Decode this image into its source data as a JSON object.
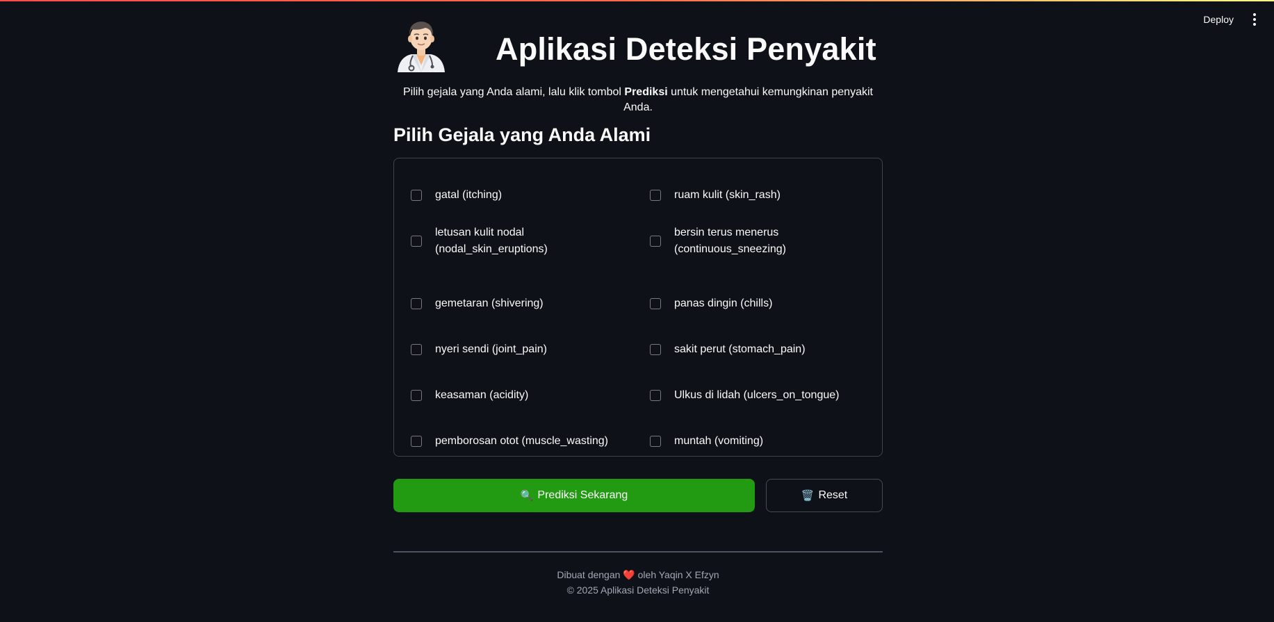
{
  "toolbar": {
    "deploy_label": "Deploy",
    "menu_icon": "kebab-menu-icon"
  },
  "header": {
    "avatar_icon": "doctor-avatar-icon",
    "title": "Aplikasi Deteksi Penyakit"
  },
  "intro": {
    "before": "Pilih gejala yang Anda alami, lalu klik tombol ",
    "bold": "Prediksi",
    "after": " untuk mengetahui kemungkinan penyakit Anda."
  },
  "section_title": "Pilih Gejala yang Anda Alami",
  "symptoms": [
    {
      "label": "gatal (itching)",
      "checked": false
    },
    {
      "label": "ruam kulit (skin_rash)",
      "checked": false
    },
    {
      "label": "letusan kulit nodal (nodal_skin_eruptions)",
      "checked": false
    },
    {
      "label": "bersin terus menerus (continuous_sneezing)",
      "checked": false
    },
    {
      "label": "gemetaran (shivering)",
      "checked": false
    },
    {
      "label": "panas dingin (chills)",
      "checked": false
    },
    {
      "label": "nyeri sendi (joint_pain)",
      "checked": false
    },
    {
      "label": "sakit perut (stomach_pain)",
      "checked": false
    },
    {
      "label": "keasaman (acidity)",
      "checked": false
    },
    {
      "label": "Ulkus di lidah (ulcers_on_tongue)",
      "checked": false
    },
    {
      "label": "pemborosan otot (muscle_wasting)",
      "checked": false
    },
    {
      "label": "muntah (vomiting)",
      "checked": false
    }
  ],
  "buttons": {
    "predict_icon": "🔍",
    "predict_label": "Prediksi Sekarang",
    "reset_icon": "🗑️",
    "reset_label": "Reset"
  },
  "footer": {
    "line1_before": "Dibuat dengan ",
    "heart": "❤️",
    "line1_after": " oleh Yaqin X Efzyn",
    "line2": "© 2025 Aplikasi Deteksi Penyakit"
  },
  "colors": {
    "background": "#0e1117",
    "primary_button": "#229a12",
    "text": "#fafafa"
  }
}
